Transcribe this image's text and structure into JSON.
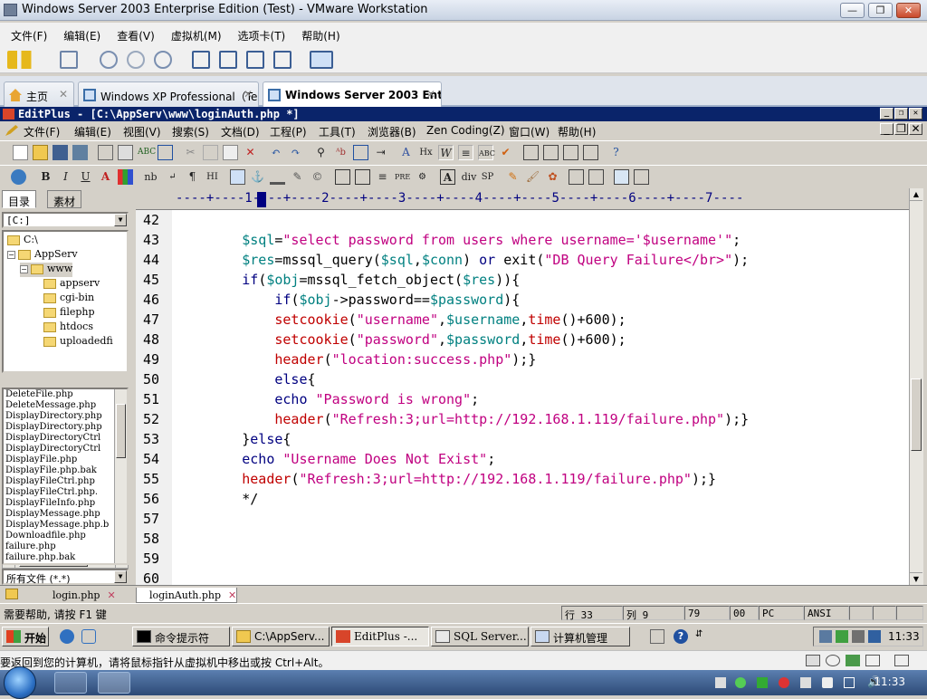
{
  "vmware": {
    "title": "Windows Server 2003 Enterprise Edition (Test) - VMware Workstation",
    "controls": {
      "min": "—",
      "max": "❐",
      "close": "✕"
    },
    "menu": [
      "文件(F)",
      "编辑(E)",
      "查看(V)",
      "虚拟机(M)",
      "选项卡(T)",
      "帮助(H)"
    ],
    "tabs": [
      {
        "label": "主页",
        "close": "✕"
      },
      {
        "label": "Windows XP Professional（Te...",
        "close": "✕"
      },
      {
        "label": "Windows Server 2003 Ent...",
        "close": "✕"
      }
    ],
    "status_message": "要返回到您的计算机，请将鼠标指针从虚拟机中移出或按 Ctrl+Alt。"
  },
  "editplus": {
    "title": "EditPlus - [C:\\AppServ\\www\\loginAuth.php *]",
    "menu": [
      "文件(F)",
      "编辑(E)",
      "视图(V)",
      "搜索(S)",
      "文档(D)",
      "工程(P)",
      "工具(T)",
      "浏览器(B)",
      "Zen Coding(Z)",
      "窗口(W)",
      "帮助(H)"
    ],
    "toolbar2_labels": {
      "bold": "B",
      "italic": "I",
      "underline": "U",
      "color": "A",
      "nb": "nb",
      "para": "¶",
      "hr": "HI",
      "pre": "PRE",
      "div": "div",
      "sp": "SP"
    },
    "left_tabs": [
      "目录",
      "素材"
    ],
    "drive": "[C:]",
    "tree": [
      {
        "label": "C:\\",
        "level": 0,
        "toggle": ""
      },
      {
        "label": "AppServ",
        "level": 0,
        "toggle": "−"
      },
      {
        "label": "www",
        "level": 1,
        "toggle": "−"
      },
      {
        "label": "appserv",
        "level": 2,
        "toggle": ""
      },
      {
        "label": "cgi-bin",
        "level": 2,
        "toggle": ""
      },
      {
        "label": "filephp",
        "level": 2,
        "toggle": ""
      },
      {
        "label": "htdocs",
        "level": 2,
        "toggle": ""
      },
      {
        "label": "uploadedfi",
        "level": 2,
        "toggle": ""
      }
    ],
    "files": [
      "DeleteFile.php",
      "DeleteMessage.php",
      "DisplayDirectory.php",
      "DisplayDirectory.php",
      "DisplayDirectoryCtrl",
      "DisplayDirectoryCtrl",
      "DisplayFile.php",
      "DisplayFile.php.bak",
      "DisplayFileCtrl.php",
      "DisplayFileCtrl.php.",
      "DisplayFileInfo.php",
      "DisplayMessage.php",
      "DisplayMessage.php.b",
      "Downloadfile.php",
      "failure.php",
      "failure.php.bak"
    ],
    "file_filter": "所有文件 (*.*)",
    "ruler": "----+----1----+----2----+----3----+----4----+----5----+----6----+----7----",
    "code_lines": [
      {
        "n": "42",
        "indent": 0,
        "segs": []
      },
      {
        "n": "43",
        "indent": 2,
        "segs": [
          [
            "v",
            "$sql"
          ],
          [
            "p",
            "="
          ],
          [
            "s",
            "\"select password from users where username='$username'\""
          ],
          [
            "p",
            ";"
          ]
        ]
      },
      {
        "n": "44",
        "indent": 2,
        "segs": [
          [
            "v",
            "$res"
          ],
          [
            "p",
            "=mssql_query("
          ],
          [
            "v",
            "$sql"
          ],
          [
            "p",
            ","
          ],
          [
            "v",
            "$conn"
          ],
          [
            "p",
            ") "
          ],
          [
            "k",
            "or"
          ],
          [
            "p",
            " exit("
          ],
          [
            "s",
            "\"DB Query Failure</br>\""
          ],
          [
            "p",
            ");"
          ]
        ]
      },
      {
        "n": "45",
        "indent": 2,
        "segs": [
          [
            "k",
            "if"
          ],
          [
            "p",
            "("
          ],
          [
            "v",
            "$obj"
          ],
          [
            "p",
            "=mssql_fetch_object("
          ],
          [
            "v",
            "$res"
          ],
          [
            "p",
            "))"
          ],
          [
            "p",
            "{"
          ]
        ]
      },
      {
        "n": "46",
        "indent": 3,
        "segs": [
          [
            "k",
            "if"
          ],
          [
            "p",
            "("
          ],
          [
            "v",
            "$obj"
          ],
          [
            "p",
            "->password=="
          ],
          [
            "v",
            "$password"
          ],
          [
            "p",
            "){"
          ]
        ]
      },
      {
        "n": "47",
        "indent": 3,
        "segs": [
          [
            "f",
            "setcookie"
          ],
          [
            "p",
            "("
          ],
          [
            "s",
            "\"username\""
          ],
          [
            "p",
            ","
          ],
          [
            "v",
            "$username"
          ],
          [
            "p",
            ","
          ],
          [
            "f",
            "time"
          ],
          [
            "p",
            "()+600);"
          ]
        ]
      },
      {
        "n": "48",
        "indent": 3,
        "segs": [
          [
            "f",
            "setcookie"
          ],
          [
            "p",
            "("
          ],
          [
            "s",
            "\"password\""
          ],
          [
            "p",
            ","
          ],
          [
            "v",
            "$password"
          ],
          [
            "p",
            ","
          ],
          [
            "f",
            "time"
          ],
          [
            "p",
            "()+600);"
          ]
        ]
      },
      {
        "n": "49",
        "indent": 3,
        "segs": [
          [
            "f",
            "header"
          ],
          [
            "p",
            "("
          ],
          [
            "s",
            "\"location:success.php\""
          ],
          [
            "p",
            ");}"
          ]
        ]
      },
      {
        "n": "50",
        "indent": 3,
        "segs": [
          [
            "k",
            "else"
          ],
          [
            "p",
            "{"
          ]
        ]
      },
      {
        "n": "51",
        "indent": 3,
        "segs": [
          [
            "k",
            "echo"
          ],
          [
            "p",
            " "
          ],
          [
            "s",
            "\"Password is wrong\""
          ],
          [
            "p",
            ";"
          ]
        ]
      },
      {
        "n": "52",
        "indent": 3,
        "segs": [
          [
            "f",
            "header"
          ],
          [
            "p",
            "("
          ],
          [
            "s",
            "\"Refresh:3;url=http://192.168.1.119/failure.php\""
          ],
          [
            "p",
            ");}"
          ]
        ]
      },
      {
        "n": "53",
        "indent": 2,
        "segs": [
          [
            "p",
            "}"
          ],
          [
            "k",
            "else"
          ],
          [
            "p",
            "{"
          ]
        ]
      },
      {
        "n": "54",
        "indent": 2,
        "segs": [
          [
            "k",
            "echo"
          ],
          [
            "p",
            " "
          ],
          [
            "s",
            "\"Username Does Not Exist\""
          ],
          [
            "p",
            ";"
          ]
        ]
      },
      {
        "n": "55",
        "indent": 2,
        "segs": [
          [
            "f",
            "header"
          ],
          [
            "p",
            "("
          ],
          [
            "s",
            "\"Refresh:3;url=http://192.168.1.119/failure.php\""
          ],
          [
            "p",
            ");}"
          ]
        ]
      },
      {
        "n": "56",
        "indent": 2,
        "segs": [
          [
            "p",
            "*/"
          ]
        ]
      },
      {
        "n": "57",
        "indent": 0,
        "segs": []
      },
      {
        "n": "58",
        "indent": 0,
        "segs": []
      },
      {
        "n": "59",
        "indent": 0,
        "segs": []
      },
      {
        "n": "60",
        "indent": 0,
        "segs": []
      }
    ],
    "doc_tabs": [
      "login.php",
      "loginAuth.php"
    ],
    "status": {
      "help": "需要帮助, 请按 F1 键",
      "line": "行 33",
      "col": "列 9",
      "c79": "79",
      "c00": "00",
      "pc": "PC",
      "enc": "ANSI"
    }
  },
  "guest_taskbar": {
    "start": "开始",
    "items": [
      "命令提示符",
      "C:\\AppServ...",
      "EditPlus -...",
      "SQL Server...",
      "计算机管理"
    ],
    "clock": "11:33"
  },
  "host_taskbar": {
    "clock": "11:33"
  },
  "colors": {
    "variable": "#008080",
    "string": "#c00080",
    "function": "#c00000",
    "keyword": "#000080"
  }
}
